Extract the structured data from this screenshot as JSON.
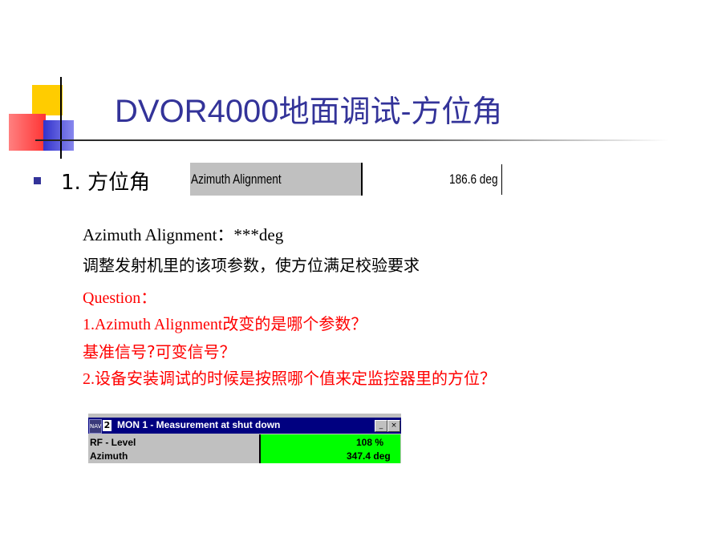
{
  "slide": {
    "title_latin": "DVOR4000",
    "title_cjk": "地面调试-方位角",
    "heading_number": "1.",
    "heading_text": "方位角"
  },
  "azimuth_panel": {
    "label": "Azimuth Alignment",
    "value": "186.6 deg"
  },
  "body": {
    "line1": "Azimuth Alignment：***deg",
    "line2": "调整发射机里的该项参数，使方位满足校验要求",
    "question_label": "Question：",
    "q1": "1.Azimuth Alignment改变的是哪个参数？",
    "q1b": "基准信号?可变信号？",
    "q2": "2.设备安装调试的时候是按照哪个值来定监控器里的方位？"
  },
  "monitor_window": {
    "icon_text": "NAV",
    "number": "2",
    "title": "MON 1  -  Measurement at shut down",
    "minimize": "_",
    "close": "×",
    "rows": [
      {
        "label": "RF - Level",
        "value": "108 %"
      },
      {
        "label": "Azimuth",
        "value": "347.4 deg"
      }
    ]
  },
  "colors": {
    "title": "#333399",
    "question": "#ff0000",
    "window_titlebar": "#000080",
    "value_bg": "#00ff00"
  }
}
